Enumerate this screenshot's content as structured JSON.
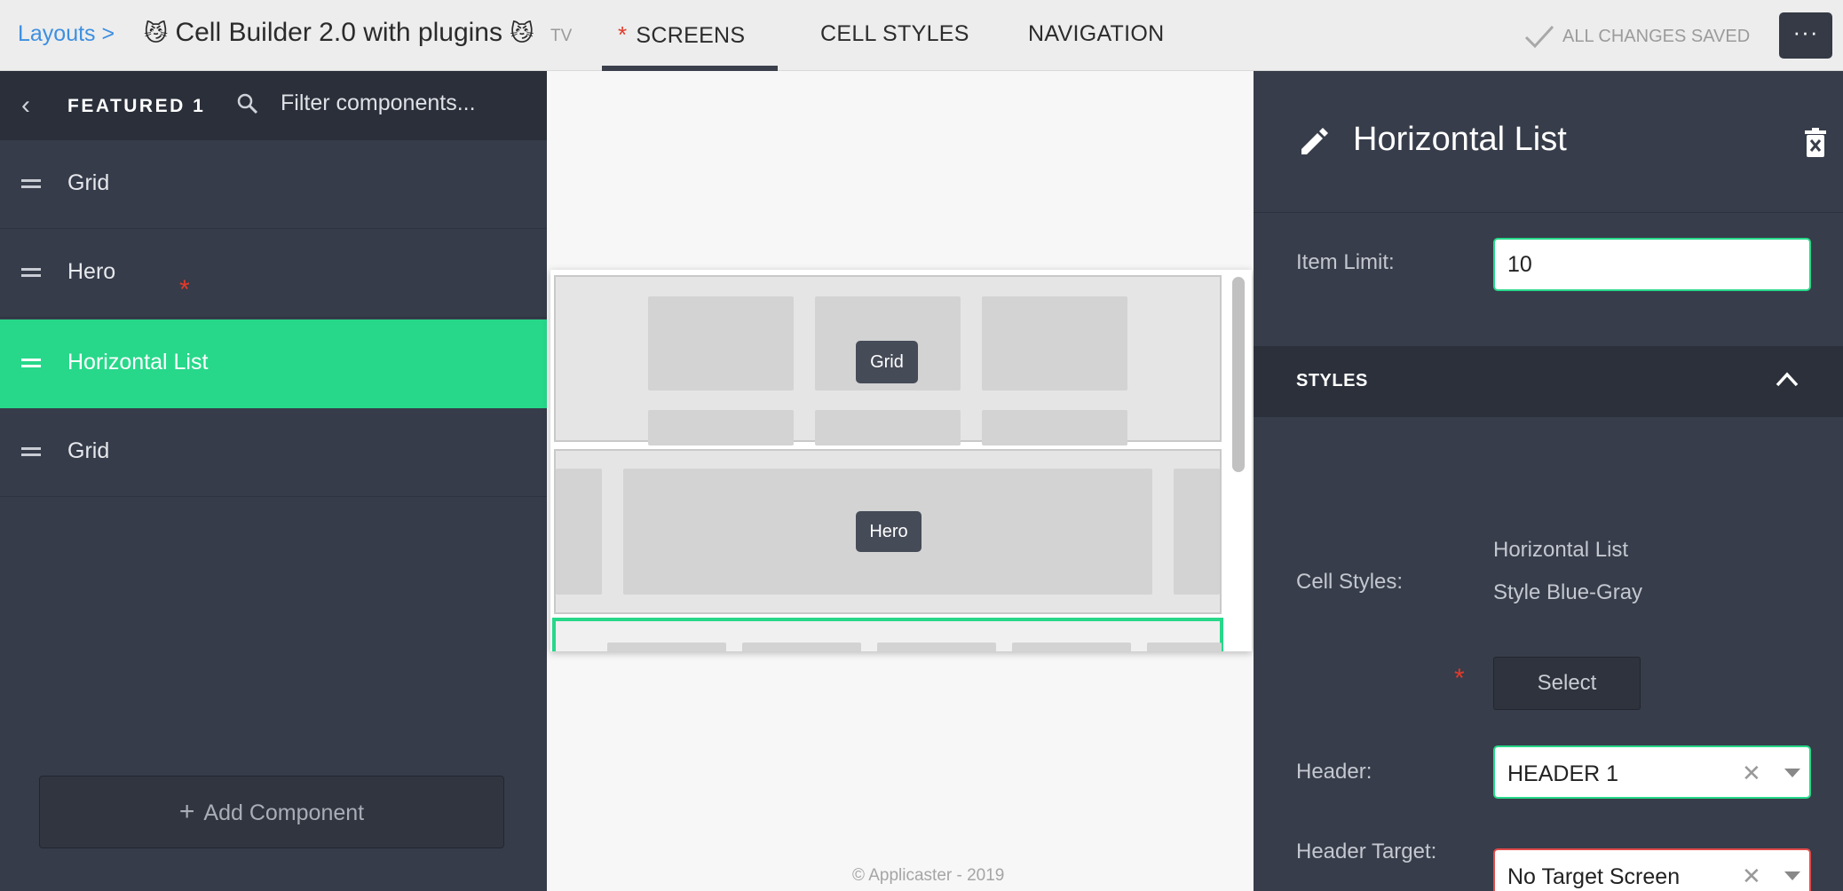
{
  "topbar": {
    "breadcrumb": "Layouts >",
    "title_emoji": "😼",
    "title": "Cell Builder 2.0 with plugins",
    "platform": "TV",
    "tabs": [
      {
        "label": "SCREENS",
        "active": true
      },
      {
        "label": "CELL STYLES"
      },
      {
        "label": "NAVIGATION"
      }
    ],
    "save_status": "ALL CHANGES SAVED",
    "more_label": "···"
  },
  "sidebar": {
    "back_glyph": "‹",
    "section": "FEATURED 1",
    "filter_placeholder": "Filter components...",
    "items": [
      {
        "label": "Grid"
      },
      {
        "label": "Hero"
      },
      {
        "label": "Horizontal List",
        "active": true
      },
      {
        "label": "Grid"
      }
    ],
    "required_marker": "*",
    "add_component_plus": "+",
    "add_component": "Add Component"
  },
  "canvas": {
    "tags": [
      "Grid",
      "Hero"
    ],
    "footer": "© Applicaster - 2019"
  },
  "panel": {
    "title": "Horizontal List",
    "item_limit_label": "Item Limit:",
    "item_limit_value": "10",
    "styles_header": "STYLES",
    "cell_styles_label": "Cell Styles:",
    "cell_styles_values": [
      "Horizontal List",
      "Style Blue-Gray"
    ],
    "required_marker": "*",
    "select_label": "Select",
    "header_label": "Header:",
    "header_value": "HEADER 1",
    "header_target_label": "Header Target:",
    "header_target_value": "No Target Screen",
    "clear_glyph": "✕"
  },
  "colors": {
    "accent": "#27d88a",
    "sidebar_bg": "#363c4a",
    "error": "#e24a4a",
    "link": "#3d8fe0"
  },
  "icons": [
    "chevron-left-icon",
    "search-icon",
    "drag-handle-icon",
    "plus-icon",
    "pencil-icon",
    "trash-icon",
    "chevron-up-icon",
    "check-icon",
    "clear-icon",
    "caret-down-icon"
  ]
}
